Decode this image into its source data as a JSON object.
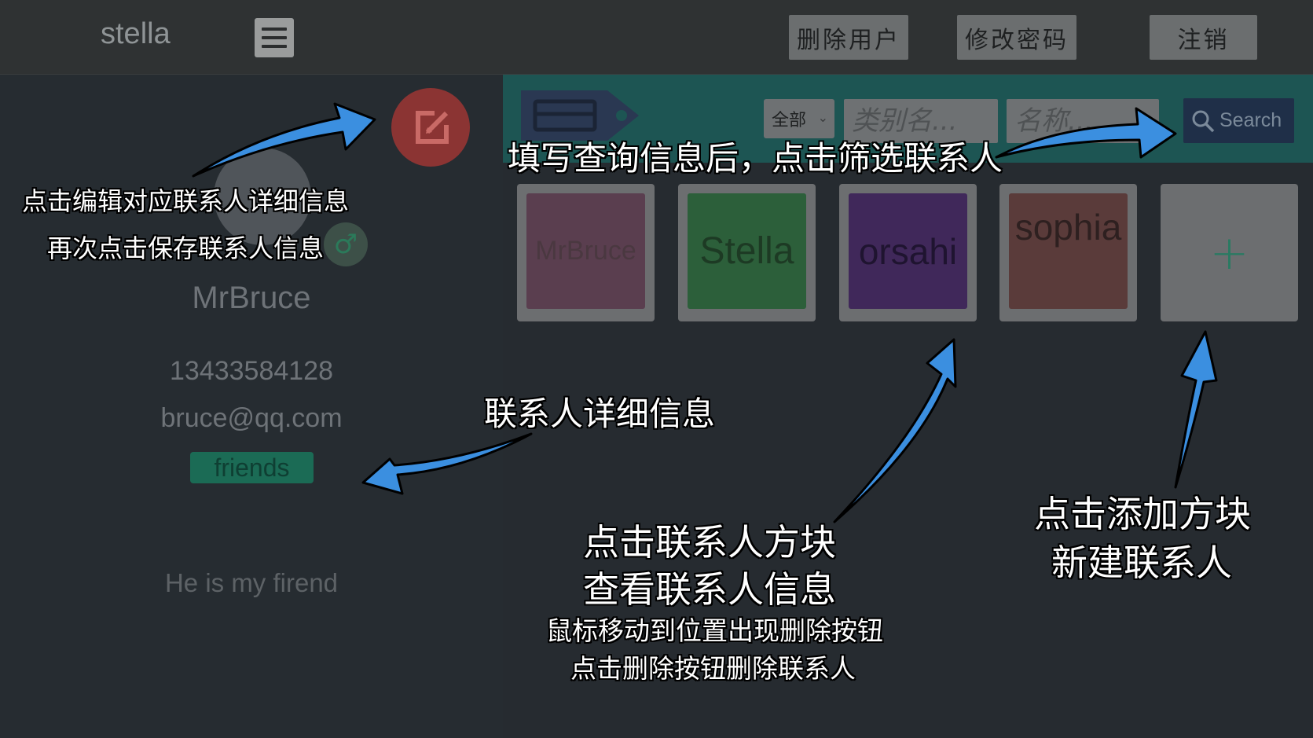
{
  "header": {
    "brand": "stella",
    "delete_user_label": "删除用户",
    "change_password_label": "修改密码",
    "logout_label": "注销"
  },
  "detail": {
    "name": "MrBruce",
    "phone": "13433584128",
    "email": "bruce@qq.com",
    "tag": "friends",
    "note": "He is my firend",
    "gender_symbol": "♂"
  },
  "filter": {
    "select_value": "全部",
    "category_placeholder": "类别名...",
    "name_placeholder": "名称...",
    "search_label": "Search"
  },
  "contacts": [
    {
      "name": "MrBruce",
      "color": "#5a3e4f",
      "text_color": "#4a3840"
    },
    {
      "name": "Stella",
      "color": "#2c5f3a",
      "text_color": "#1d3a24"
    },
    {
      "name": "orsahi",
      "color": "#40285a",
      "text_color": "#1f1430"
    },
    {
      "name": "sophia",
      "color": "#5a3b3a",
      "text_color": "#2e2020"
    }
  ],
  "add_tile_symbol": "+",
  "annotations": {
    "edit_line1": "点击编辑对应联系人详细信息",
    "edit_line2": "再次点击保存联系人信息",
    "filter_hint": "填写查询信息后，点击筛选联系人",
    "detail_hint": "联系人详细信息",
    "tile_line1": "点击联系人方块",
    "tile_line2": "查看联系人信息",
    "tile_line3": "鼠标移动到位置出现删除按钮",
    "tile_line4": "点击删除按钮删除联系人",
    "add_line1": "点击添加方块",
    "add_line2": "新建联系人"
  },
  "colors": {
    "annotation_arrow": "#3b8fe0",
    "edit_button": "#8b3433",
    "filter_bar": "#1d5553",
    "tag_bg": "#1b6b55"
  }
}
